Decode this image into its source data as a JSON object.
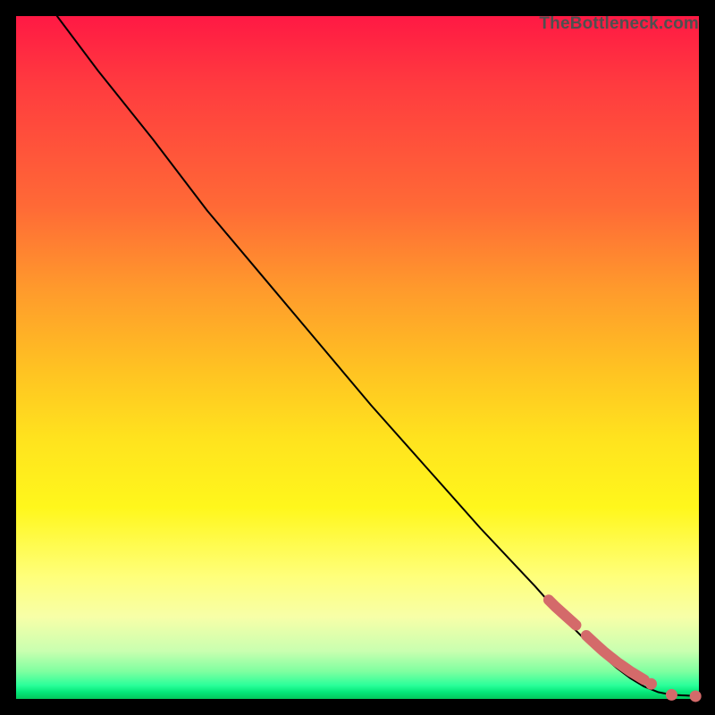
{
  "attribution": "TheBottleneck.com",
  "colors": {
    "curve": "#000000",
    "dots": "#d46a6a",
    "background_top": "#ff1944",
    "background_bottom": "#04c85c"
  },
  "chart_data": {
    "type": "line",
    "title": "",
    "xlabel": "",
    "ylabel": "",
    "xlim": [
      0,
      100
    ],
    "ylim": [
      0,
      100
    ],
    "grid": false,
    "legend": null,
    "series": [
      {
        "name": "curve",
        "kind": "line",
        "x": [
          6,
          12,
          20,
          28,
          36,
          44,
          52,
          60,
          68,
          76,
          80,
          84,
          88,
          90,
          92,
          94,
          96,
          98,
          100
        ],
        "y": [
          100,
          92,
          82,
          71.5,
          62,
          52.5,
          43,
          34,
          25,
          16.5,
          12,
          8,
          4.5,
          3,
          1.8,
          1,
          0.6,
          0.5,
          0.4
        ]
      },
      {
        "name": "highlighted-points",
        "kind": "scatter",
        "x": [
          78,
          79,
          80,
          81,
          82,
          83.5,
          85,
          86,
          87,
          88,
          89,
          90,
          91,
          92,
          93,
          96,
          99.5
        ],
        "y": [
          14.5,
          13.5,
          12.6,
          11.7,
          10.8,
          9.3,
          7.9,
          7,
          6.2,
          5.4,
          4.7,
          4,
          3.4,
          2.8,
          2.2,
          0.6,
          0.4
        ]
      }
    ],
    "annotations": []
  }
}
